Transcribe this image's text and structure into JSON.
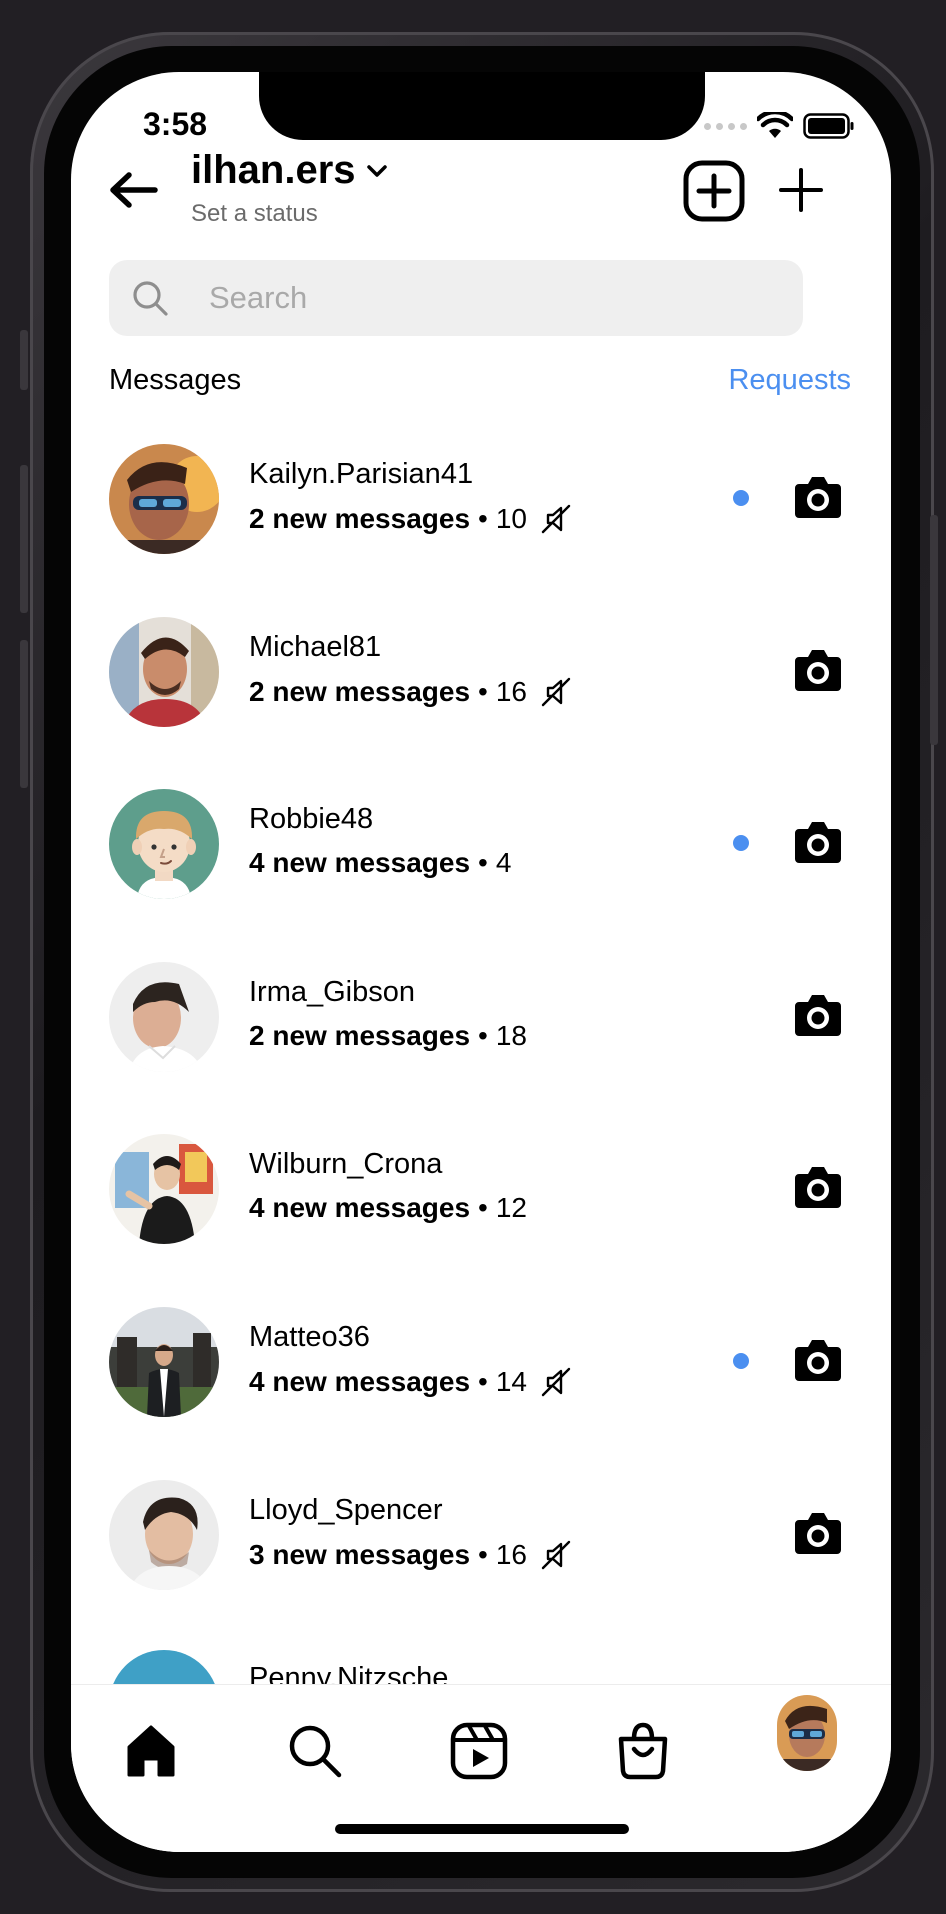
{
  "status_bar": {
    "time": "3:58"
  },
  "header": {
    "username": "ilhan.ers",
    "status": "Set a status"
  },
  "search": {
    "placeholder": "Search"
  },
  "section": {
    "title": "Messages",
    "requests_label": "Requests"
  },
  "conversations": [
    {
      "name": "Kailyn.Parisian41",
      "messages": "2 new messages",
      "time": "10",
      "muted": true,
      "unread": true
    },
    {
      "name": "Michael81",
      "messages": "2 new messages",
      "time": "16",
      "muted": true,
      "unread": false
    },
    {
      "name": "Robbie48",
      "messages": "4 new messages",
      "time": "4",
      "muted": false,
      "unread": true
    },
    {
      "name": "Irma_Gibson",
      "messages": "2 new messages",
      "time": "18",
      "muted": false,
      "unread": false
    },
    {
      "name": "Wilburn_Crona",
      "messages": "4 new messages",
      "time": "12",
      "muted": false,
      "unread": false
    },
    {
      "name": "Matteo36",
      "messages": "4 new messages",
      "time": "14",
      "muted": true,
      "unread": true
    },
    {
      "name": "Lloyd_Spencer",
      "messages": "3 new messages",
      "time": "16",
      "muted": true,
      "unread": false
    }
  ],
  "partial_row_name": "Penny.Nitzsche",
  "separator": "•",
  "colors": {
    "accent": "#4b8ff0",
    "search_bg": "#efefef",
    "muted_text": "#6b6b6b"
  },
  "tabs": [
    "home-icon",
    "search-icon",
    "reels-icon",
    "shop-icon",
    "profile-avatar"
  ]
}
